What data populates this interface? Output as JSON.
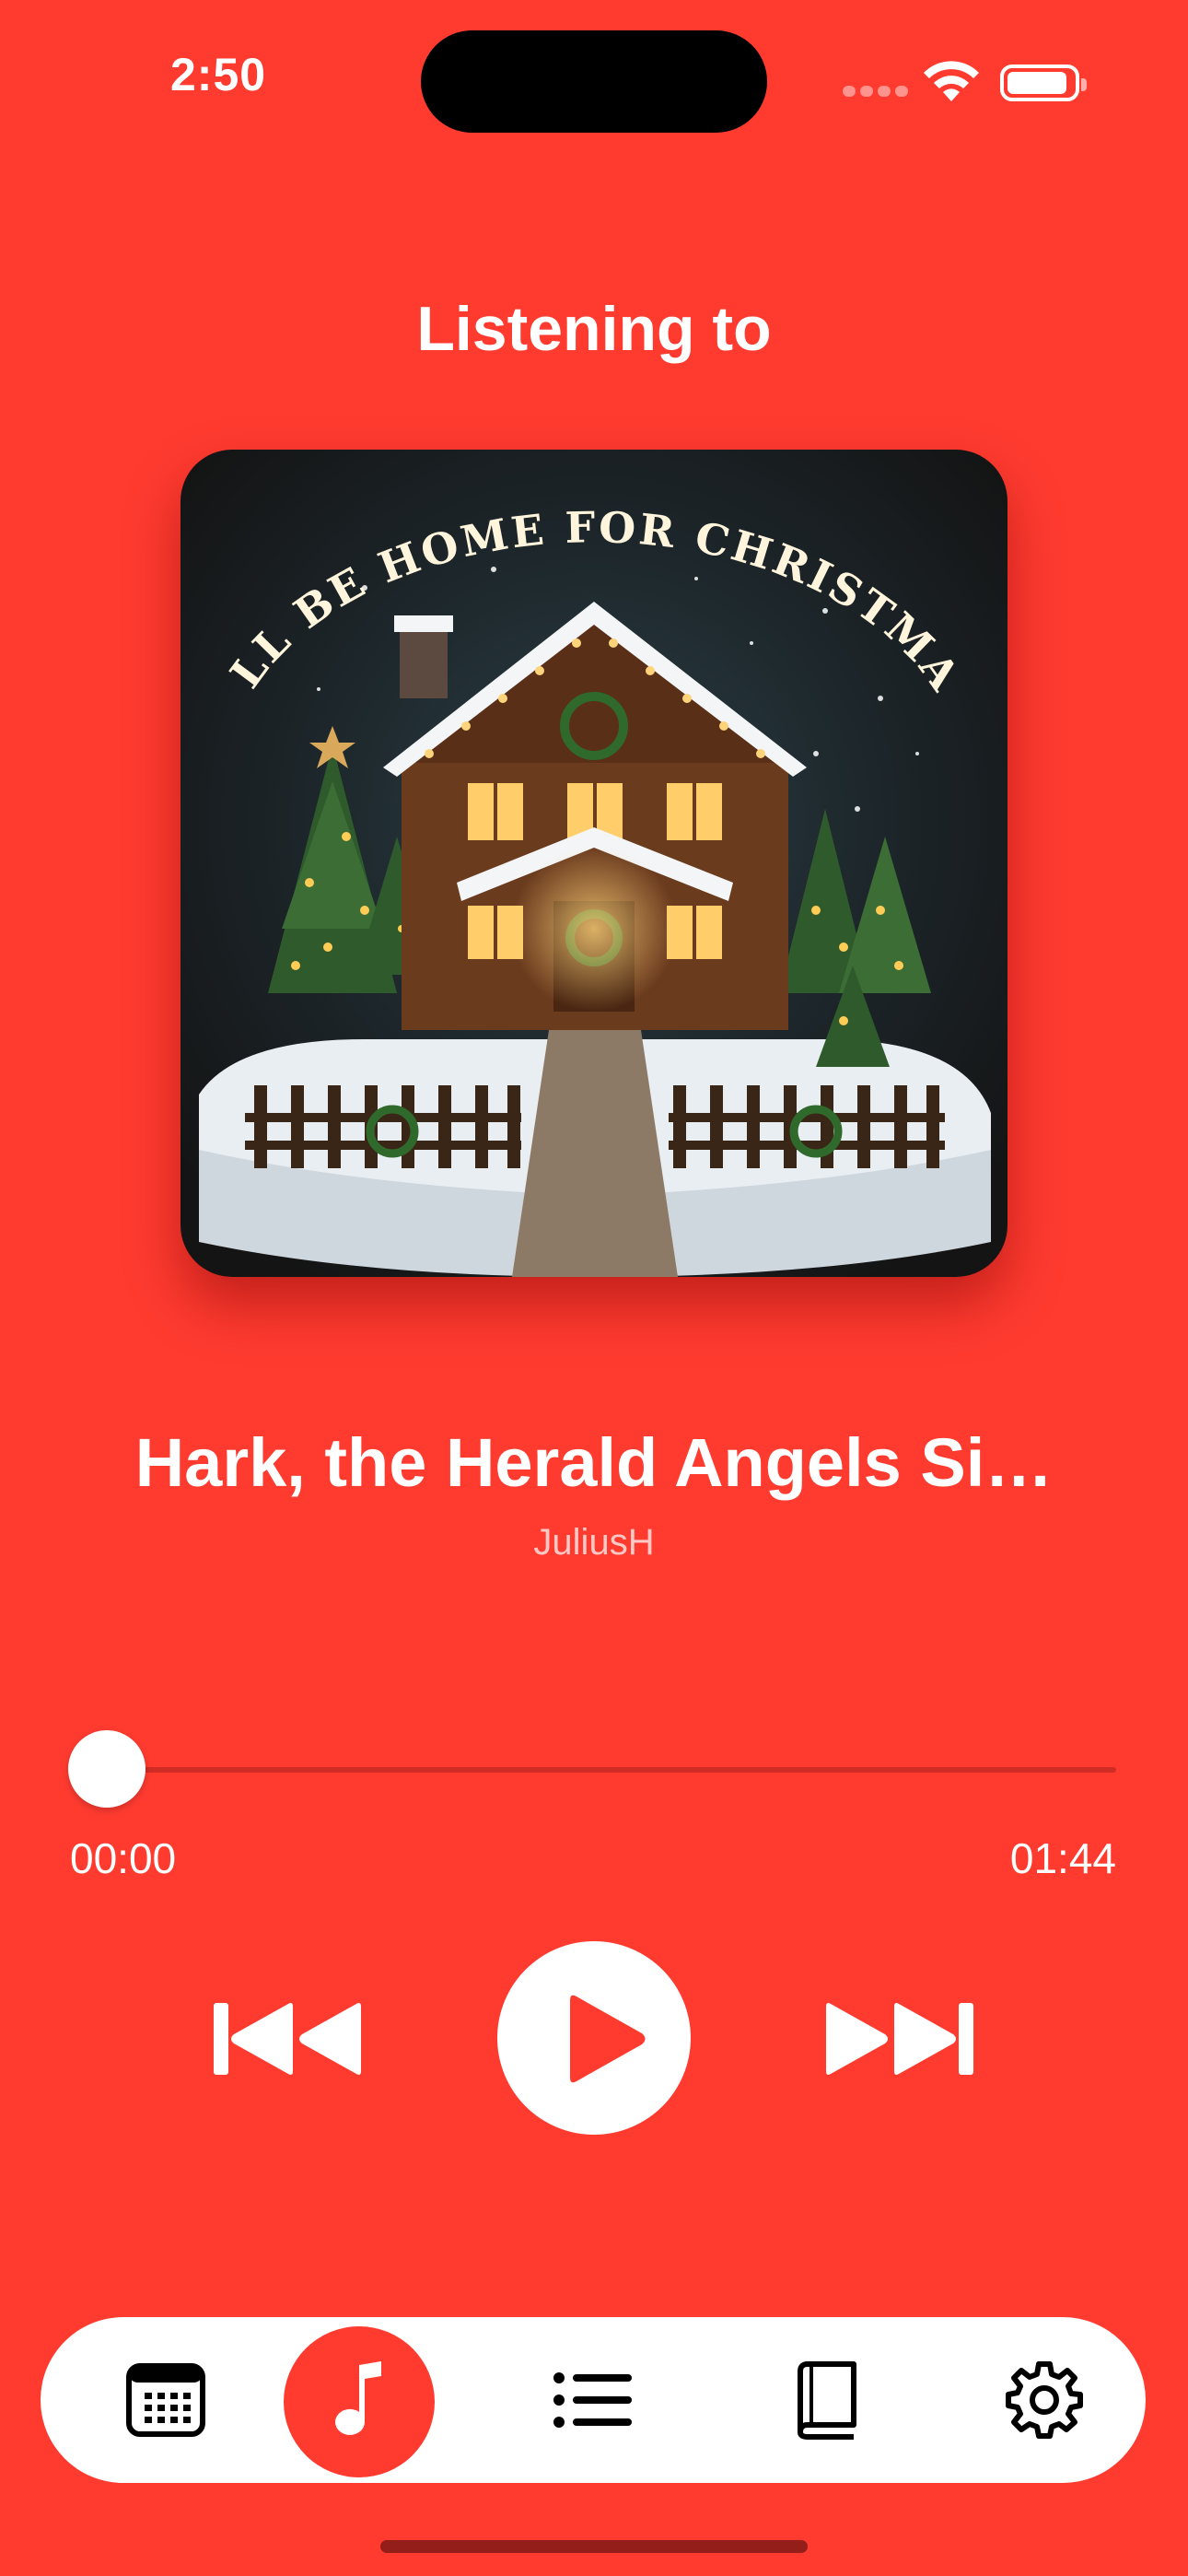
{
  "status_bar": {
    "time": "2:50"
  },
  "header": {
    "title": "Listening to"
  },
  "artwork": {
    "text": "I'LL BE HOME FOR CHRISTMAS"
  },
  "track": {
    "title": "Hark, the Herald Angels Si…",
    "artist": "JuliusH"
  },
  "progress": {
    "elapsed": "00:00",
    "duration": "01:44",
    "fraction": 0.0
  },
  "controls": {
    "previous_icon": "backward-end-icon",
    "play_icon": "play-icon",
    "next_icon": "forward-end-icon"
  },
  "tab_bar": {
    "items": [
      {
        "icon": "calendar-icon",
        "active": false
      },
      {
        "icon": "music-note-icon",
        "active": true
      },
      {
        "icon": "list-icon",
        "active": false
      },
      {
        "icon": "book-icon",
        "active": false
      },
      {
        "icon": "gear-icon",
        "active": false
      }
    ]
  },
  "colors": {
    "accent": "#FF3B30",
    "surface": "#FFFFFF",
    "icon": "#000000"
  }
}
